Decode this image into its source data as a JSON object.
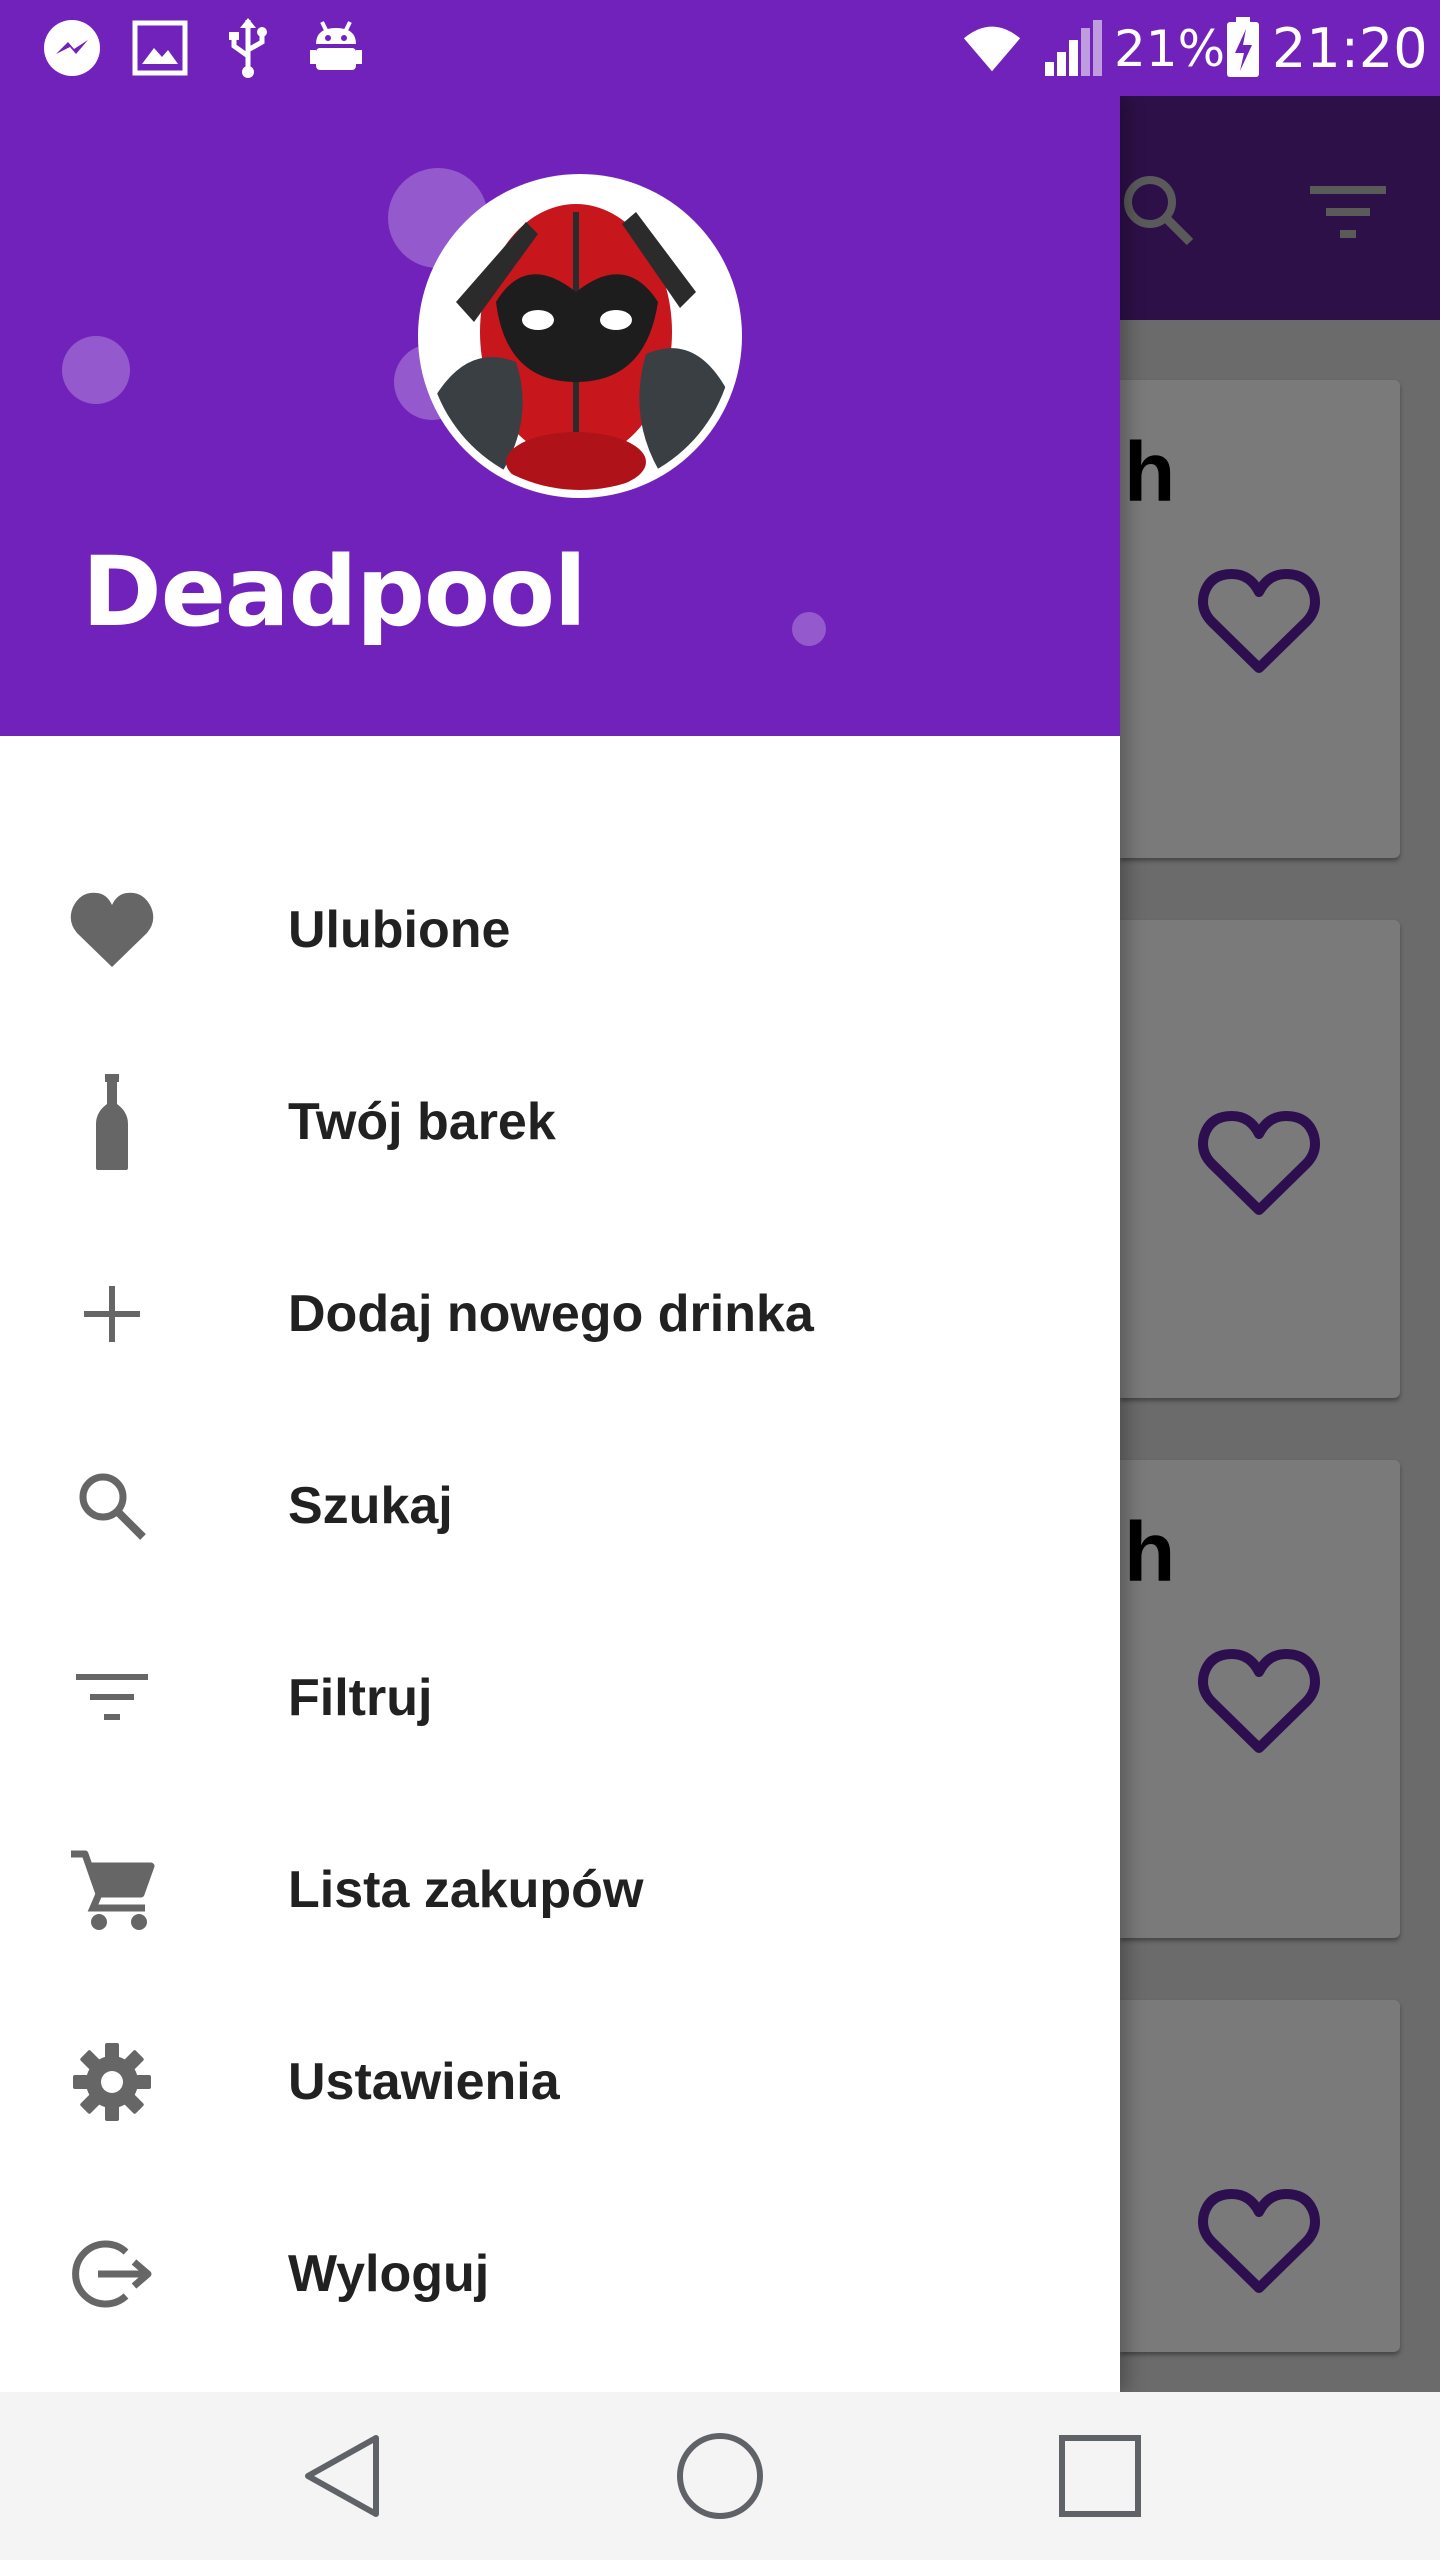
{
  "status_bar": {
    "battery_percent": "21%",
    "time": "21:20",
    "icons": [
      "messenger-icon",
      "image-icon",
      "usb-icon",
      "android-debug-icon",
      "wifi-icon",
      "signal-icon",
      "battery-charging-icon"
    ]
  },
  "drawer": {
    "user_name": "Deadpool",
    "header_color": "#7122bb",
    "menu": [
      {
        "label": "Ulubione",
        "icon": "heart-icon"
      },
      {
        "label": "Twój barek",
        "icon": "bottle-icon"
      },
      {
        "label": "Dodaj nowego drinka",
        "icon": "plus-icon"
      },
      {
        "label": "Szukaj",
        "icon": "search-icon"
      },
      {
        "label": "Filtruj",
        "icon": "filter-icon"
      },
      {
        "label": "Lista zakupów",
        "icon": "cart-icon"
      },
      {
        "label": "Ustawienia",
        "icon": "gear-icon"
      },
      {
        "label": "Wyloguj",
        "icon": "logout-icon"
      }
    ]
  },
  "background": {
    "toolbar_icons": [
      "search-icon",
      "filter-icon"
    ],
    "cards": [
      {
        "text_fragment": "h"
      },
      {
        "text_fragment": ""
      },
      {
        "text_fragment": "h"
      },
      {
        "text_fragment": ""
      }
    ],
    "accent_color": "#2d0f4f"
  },
  "nav_bar": {
    "buttons": [
      "back-icon",
      "home-icon",
      "recents-icon"
    ]
  }
}
